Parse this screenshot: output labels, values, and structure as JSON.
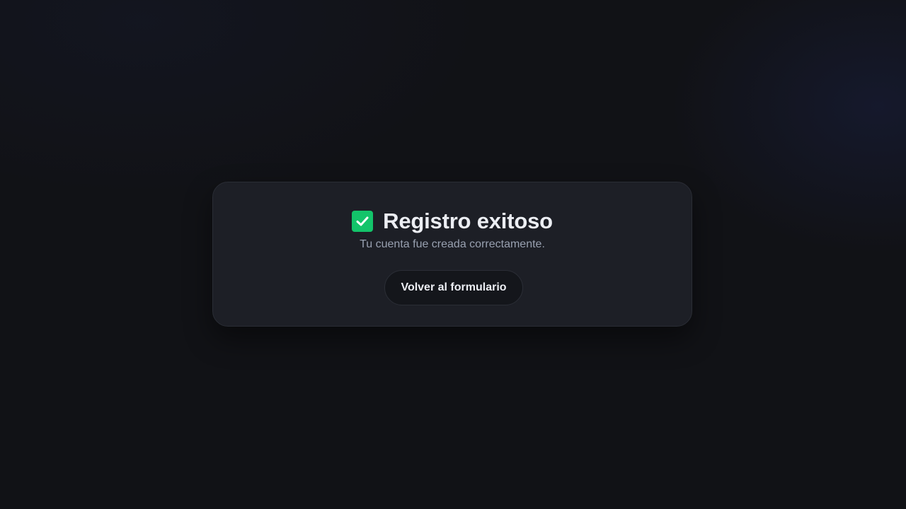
{
  "card": {
    "title": "Registro exitoso",
    "subtitle": "Tu cuenta fue creada correctamente.",
    "button_label": "Volver al formulario",
    "icon": "check-icon"
  },
  "colors": {
    "background": "#111216",
    "card": "#1d1f26",
    "accent_green": "#13c46a",
    "title_text": "#eceef3",
    "subtitle_text": "#98a0b0"
  }
}
